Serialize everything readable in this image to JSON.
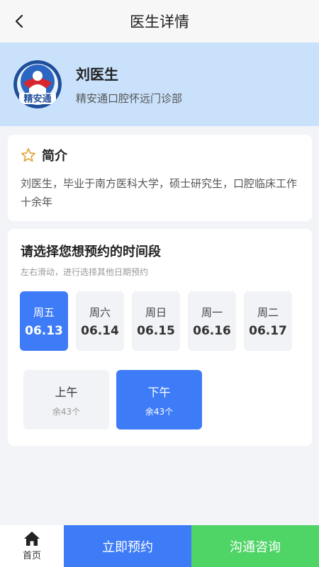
{
  "header": {
    "title": "医生详情",
    "back_icon": "chevron-left-icon"
  },
  "doctor": {
    "name": "刘医生",
    "clinic": "精安通口腔怀远门诊部",
    "logo_text": "精安通"
  },
  "intro": {
    "icon": "star-outline-icon",
    "title": "简介",
    "text": "刘医生，毕业于南方医科大学，硕士研究生，口腔临床工作十余年"
  },
  "schedule": {
    "title": "请选择您想预约的时间段",
    "hint": "左右滑动，进行选择其他日期预约",
    "days": [
      {
        "weekday": "周五",
        "date": "06.13",
        "selected": true
      },
      {
        "weekday": "周六",
        "date": "06.14",
        "selected": false
      },
      {
        "weekday": "周日",
        "date": "06.15",
        "selected": false
      },
      {
        "weekday": "周一",
        "date": "06.16",
        "selected": false
      },
      {
        "weekday": "周二",
        "date": "06.17",
        "selected": false
      }
    ],
    "slots": [
      {
        "label": "上午",
        "remaining": "余43个",
        "selected": false
      },
      {
        "label": "下午",
        "remaining": "余43个",
        "selected": true
      }
    ]
  },
  "bottom_bar": {
    "home_label": "首页",
    "home_icon": "home-icon",
    "book_label": "立即预约",
    "consult_label": "沟通咨询"
  },
  "colors": {
    "accent": "#3d7bf7",
    "consult": "#4fd466",
    "banner": "#c9e1fb",
    "star": "#e0a23a"
  }
}
